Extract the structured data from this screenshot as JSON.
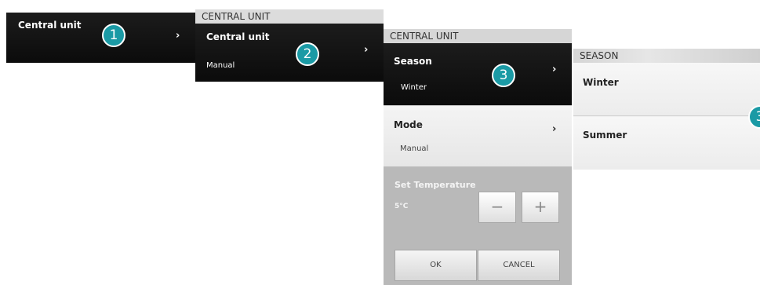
{
  "panel1": {
    "title": "Central unit",
    "badge": "1"
  },
  "panel2": {
    "header": "CENTRAL UNIT",
    "title": "Central unit",
    "subtitle": "Manual",
    "badge": "2"
  },
  "panel3": {
    "header": "CENTRAL UNIT",
    "season_title": "Season",
    "season_value": "Winter",
    "badge": "3",
    "mode_title": "Mode",
    "mode_value": "Manual",
    "set_temp_label": "Set Temperature",
    "temp_value": "5°C",
    "minus": "−",
    "plus": "+",
    "ok": "OK",
    "cancel": "CANCEL"
  },
  "panel4": {
    "header": "SEASON",
    "options": [
      "Winter",
      "Summer"
    ],
    "badge": "3"
  },
  "colors": {
    "badge": "#1a9aa5",
    "dark_panel": "#111111",
    "gray_panel": "#b9b9b9"
  },
  "icons": {
    "chevron": "chevron-right-icon"
  }
}
